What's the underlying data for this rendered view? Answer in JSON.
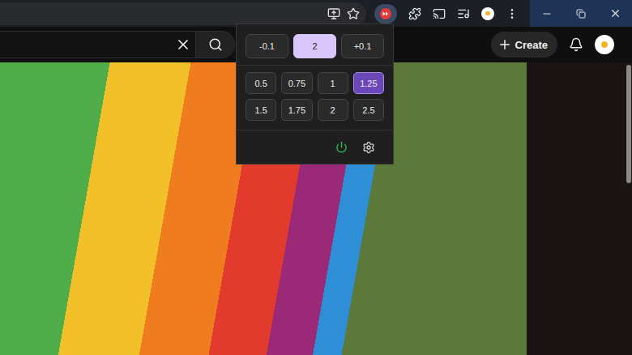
{
  "header": {
    "create_button": "Create"
  },
  "speed_popup": {
    "decrement": "-0.1",
    "current": "2",
    "increment": "+0.1",
    "presets": [
      {
        "label": "0.5",
        "selected": false
      },
      {
        "label": "0.75",
        "selected": false
      },
      {
        "label": "1",
        "selected": false
      },
      {
        "label": "1.25",
        "selected": true
      },
      {
        "label": "1.5",
        "selected": false
      },
      {
        "label": "1.75",
        "selected": false
      },
      {
        "label": "2",
        "selected": false
      },
      {
        "label": "2.5",
        "selected": false
      }
    ],
    "enabled": true
  }
}
